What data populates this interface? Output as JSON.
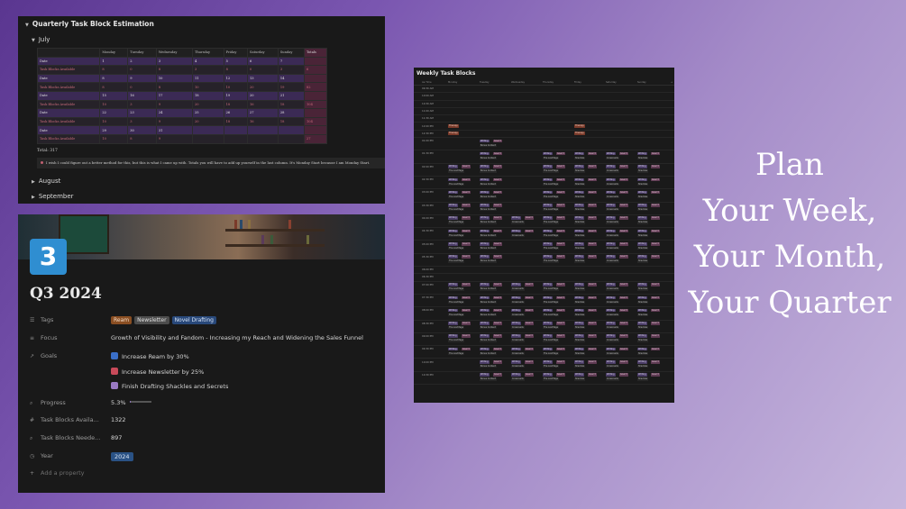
{
  "quarterly": {
    "title": "Quarterly Task Block Estimation",
    "month_july": "July",
    "month_august": "August",
    "month_september": "September",
    "col_headers": [
      "",
      "Monday",
      "Tuesday",
      "Wednesday",
      "Thursday",
      "Friday",
      "Saturday",
      "Sunday",
      "Totals"
    ],
    "rows": [
      {
        "kind": "date",
        "label": "Date",
        "cells": [
          "1",
          "2",
          "3",
          "4",
          "5",
          "6",
          "7"
        ],
        "total": ""
      },
      {
        "kind": "tb",
        "label": "Task Blocks Available",
        "cells": [
          "8",
          "0",
          "8",
          "3",
          "8",
          "0",
          "3"
        ],
        "total": "6"
      },
      {
        "kind": "date",
        "label": "Date",
        "cells": [
          "8",
          "9",
          "10",
          "11",
          "12",
          "13",
          "14"
        ],
        "total": ""
      },
      {
        "kind": "tb",
        "label": "Task Blocks Available",
        "cells": [
          "8",
          "0",
          "8",
          "10",
          "10",
          "20",
          "19"
        ],
        "total": "82"
      },
      {
        "kind": "date",
        "label": "Date",
        "cells": [
          "15",
          "16",
          "17",
          "18",
          "19",
          "20",
          "21"
        ],
        "total": ""
      },
      {
        "kind": "tb",
        "label": "Task Blocks Available",
        "cells": [
          "10",
          "3",
          "9",
          "20",
          "18",
          "16",
          "18"
        ],
        "total": "104"
      },
      {
        "kind": "date",
        "label": "Date",
        "cells": [
          "22",
          "23",
          "24",
          "25",
          "26",
          "27",
          "28"
        ],
        "total": ""
      },
      {
        "kind": "tb",
        "label": "Task Blocks Available",
        "cells": [
          "10",
          "3",
          "9",
          "20",
          "18",
          "16",
          "18"
        ],
        "total": "104"
      },
      {
        "kind": "date",
        "label": "Date",
        "cells": [
          "29",
          "30",
          "31",
          "",
          "",
          "",
          ""
        ],
        "total": ""
      },
      {
        "kind": "tb",
        "label": "Task Blocks Available",
        "cells": [
          "10",
          "8",
          "9",
          "",
          "",
          "",
          ""
        ],
        "total": "27"
      }
    ],
    "total_text": "Total: 317",
    "note": "I wish I could figure out a better method for this, but this is what I came up with. Totals you will have to add up yourself in the last column. It's Monday Start because I am Monday Start."
  },
  "project": {
    "icon_text": "3",
    "title": "Q3 2024",
    "tags_label": "Tags",
    "tags": [
      {
        "text": "Ream",
        "bg": "#8a4e22",
        "fg": "#f3dcc8"
      },
      {
        "text": "Newsletter",
        "bg": "#4c4c4c",
        "fg": "#e0e0e0"
      },
      {
        "text": "Novel Drafting",
        "bg": "#28487a",
        "fg": "#d8e4f5"
      }
    ],
    "focus_label": "Focus",
    "focus_value": "Growth of Visibility and Fandom - Increasing my Reach and Widening the Sales Funnel",
    "goals_label": "Goals",
    "goals": [
      {
        "text": "Increase Ream by 30%",
        "color": "#3a6fc8"
      },
      {
        "text": "Increase Newsletter by 25%",
        "color": "#c84a5a"
      },
      {
        "text": "Finish Drafting Shackles and Secrets",
        "color": "#9a7ac4"
      }
    ],
    "progress_label": "Progress",
    "progress_value": "5.3%",
    "progress_fraction": 0.053,
    "tba_label": "Task Blocks Availa...",
    "tba_value": "1322",
    "tbn_label": "Task Blocks Neede...",
    "tbn_value": "897",
    "year_label": "Year",
    "year_value": "2024",
    "add_property": "Add a property"
  },
  "weekly": {
    "title": "Weekly Task Blocks",
    "headers": [
      "Aa Time",
      "Monday",
      "Tuesday",
      "Wednesday",
      "Thursday",
      "Friday",
      "Saturday",
      "Sunday",
      "+"
    ],
    "times": [
      "09:30 AM",
      "10:00 AM",
      "10:30 AM",
      "11:00 AM",
      "11:30 AM",
      "12:00 PM",
      "12:30 PM",
      "01:00 PM",
      "01:30 PM",
      "02:00 PM",
      "02:30 PM",
      "03:00 PM",
      "03:30 PM",
      "04:00 PM",
      "04:30 PM",
      "05:00 PM",
      "05:30 PM",
      "06:00 PM",
      "06:30 PM",
      "07:00 PM",
      "07:30 PM",
      "08:00 PM",
      "08:30 PM",
      "09:00 PM",
      "09:30 PM",
      "10:00 PM",
      "10:30 PM"
    ],
    "chip_writing": "Writing",
    "chip_goal": "Goal 3",
    "chip_therapy": "Therapy",
    "subs": [
      "The Lost Page",
      "Bonus Content",
      "Unnamed",
      "Crossroads",
      "Shackles",
      "Expanded Scene"
    ]
  },
  "hero": {
    "lines": [
      "Plan",
      "Your Week,",
      "Your Month,",
      "Your Quarter"
    ]
  }
}
